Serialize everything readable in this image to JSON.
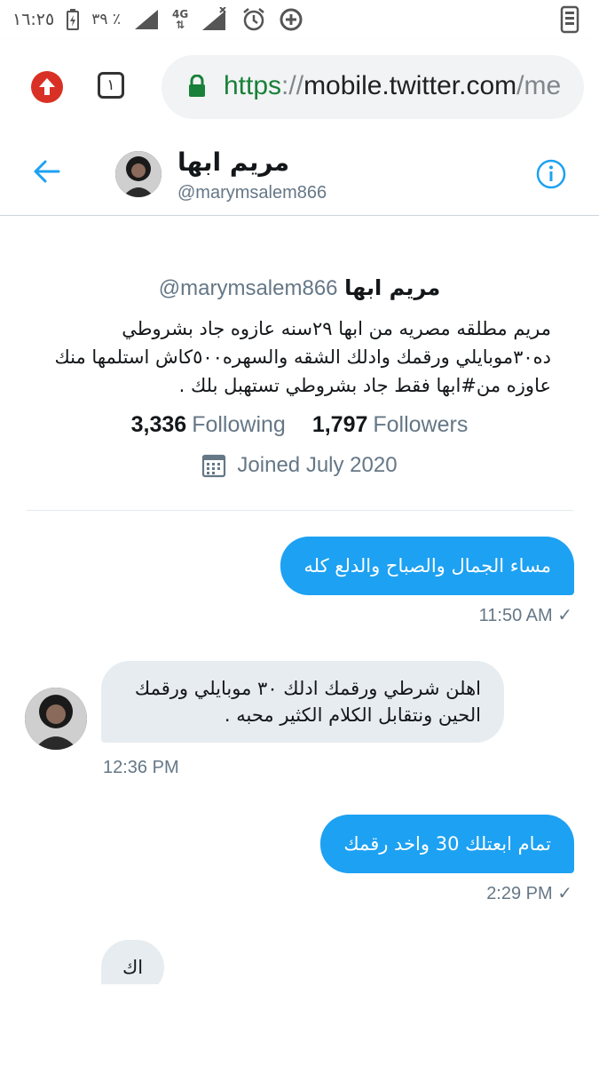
{
  "status_bar": {
    "time": "١٦:٢٥",
    "battery_percent": "٣٩ ٪",
    "network": "4G",
    "icons": [
      "battery-charging-icon",
      "signal-icon",
      "data-arrows-icon",
      "signal-no-service-icon",
      "alarm-icon",
      "data-saver-icon",
      "phone-icon"
    ]
  },
  "browser": {
    "tab_count": "١",
    "url_scheme": "https",
    "url_sep": "://",
    "url_host": "mobile.twitter.com",
    "url_tail": "/me",
    "colors": {
      "scheme": "#188038",
      "upload_button": "#d93025"
    }
  },
  "conversation_header": {
    "name": "مريم ابها",
    "handle": "@marymsalem866"
  },
  "profile": {
    "name": "مريم ابها",
    "handle": "@marymsalem866",
    "bio": "مريم مطلقه مصريه من ابها ٢٩سنه عازوه جاد بشروطي ده٣٠موبايلي ورقمك وادلك الشقه والسهره٥٠٠كاش استلمها منك عاوزه من#ابها فقط جاد بشروطي تستهبل بلك .",
    "following_count": "3,336",
    "following_label": "Following",
    "followers_count": "1,797",
    "followers_label": "Followers",
    "joined": "Joined July 2020"
  },
  "messages": [
    {
      "direction": "sent",
      "text": "مساء الجمال والصباح والدلع كله",
      "time": "11:50 AM"
    },
    {
      "direction": "received",
      "text": "اهلن شرطي ورقمك ادلك ٣٠ موبايلي ورقمك الحين ونتقابل الكلام الكثير محبه .",
      "time": "12:36 PM"
    },
    {
      "direction": "sent",
      "text": "تمام ابعتلك 30 واخد رقمك",
      "time": "2:29 PM"
    },
    {
      "direction": "received",
      "text": "اك",
      "time": ""
    }
  ],
  "colors": {
    "accent": "#1da1f2",
    "secondary_text": "#657786",
    "received_bubble": "#e6ecf0"
  }
}
